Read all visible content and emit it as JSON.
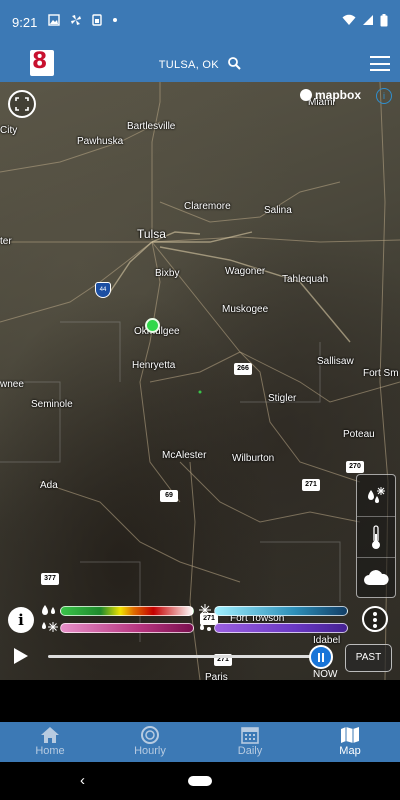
{
  "status_bar": {
    "time": "9:21",
    "left_icons": [
      "image-icon",
      "fan-icon",
      "sim-icon",
      "dot-icon"
    ],
    "right_icons": [
      "wifi-icon",
      "signal-icon",
      "battery-icon"
    ]
  },
  "header": {
    "logo_text": "8",
    "location": "TULSA, OK"
  },
  "map": {
    "attribution": "mapbox",
    "info_glyph": "i",
    "cities": [
      {
        "name": "Miami"
      },
      {
        "name": "City"
      },
      {
        "name": "Bartlesville"
      },
      {
        "name": "Pawhuska"
      },
      {
        "name": "Claremore"
      },
      {
        "name": "Salina"
      },
      {
        "name": "Tulsa"
      },
      {
        "name": "ter"
      },
      {
        "name": "Bixby"
      },
      {
        "name": "Wagoner"
      },
      {
        "name": "Tahlequah"
      },
      {
        "name": "Muskogee"
      },
      {
        "name": "Okmulgee"
      },
      {
        "name": "Henryetta"
      },
      {
        "name": "Sallisaw"
      },
      {
        "name": "Fort Sm"
      },
      {
        "name": "wnee"
      },
      {
        "name": "Seminole"
      },
      {
        "name": "Stigler"
      },
      {
        "name": "Poteau"
      },
      {
        "name": "McAlester"
      },
      {
        "name": "Wilburton"
      },
      {
        "name": "Ada"
      },
      {
        "name": "Fort Towson"
      },
      {
        "name": "Idabel"
      },
      {
        "name": "Paris"
      }
    ],
    "shields": [
      "266",
      "270",
      "271",
      "69",
      "377",
      "271",
      "271"
    ],
    "interstate": "44"
  },
  "legend": {
    "info_glyph": "i",
    "colors": {
      "rain": "#c40000",
      "snow": "#b6347f",
      "cold": "#2d8fb8",
      "mix": "#6a38c4"
    }
  },
  "layers": [
    "precip-type-icon",
    "thermometer-icon",
    "cloud-icon"
  ],
  "timeline": {
    "now_label": "NOW",
    "past_label": "PAST",
    "progress": 0.99
  },
  "tabs": [
    {
      "label": "Home",
      "icon": "home-icon",
      "active": false
    },
    {
      "label": "Hourly",
      "icon": "clock-icon",
      "active": false
    },
    {
      "label": "Daily",
      "icon": "calendar-icon",
      "active": false
    },
    {
      "label": "Map",
      "icon": "map-icon",
      "active": true
    }
  ],
  "nav": {
    "back_glyph": "‹"
  }
}
